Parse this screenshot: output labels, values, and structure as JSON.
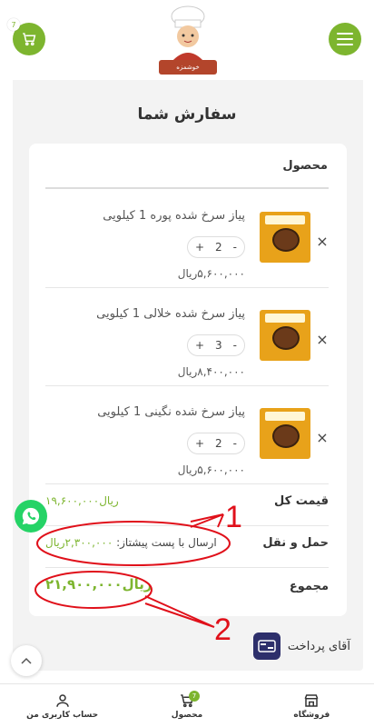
{
  "header": {
    "cart_count": "7",
    "logo_text": "خوشمزه"
  },
  "page": {
    "title": "سفارش شما"
  },
  "order": {
    "column_header": "محصول",
    "items": [
      {
        "name": "پیاز سرخ شده پوره 1 کیلویی",
        "qty": "2",
        "price": "۵,۶۰۰,۰۰۰ریال",
        "remove": "×",
        "minus": "-",
        "plus": "+"
      },
      {
        "name": "پیاز سرخ شده خلالی 1 کیلویی",
        "qty": "3",
        "price": "۸,۴۰۰,۰۰۰ریال",
        "remove": "×",
        "minus": "-",
        "plus": "+"
      },
      {
        "name": "پیاز سرخ شده نگینی 1 کیلویی",
        "qty": "2",
        "price": "۵,۶۰۰,۰۰۰ریال",
        "remove": "×",
        "minus": "-",
        "plus": "+"
      }
    ],
    "subtotal_label": "قیمت کل",
    "subtotal_value": "۱۹,۶۰۰,۰۰۰ریال",
    "shipping_label": "حمل و نقل",
    "shipping_method": "ارسال با پست پیشتاز:",
    "shipping_value": "۲,۳۰۰,۰۰۰ریال",
    "total_label": "مجموع",
    "total_value": "۲۱,۹۰۰,۰۰۰ریال"
  },
  "payment": {
    "label": "آقای پرداخت"
  },
  "annotations": {
    "marker_1": "1",
    "marker_2": "2"
  },
  "bottom_nav": {
    "shop_label": "فروشگاه",
    "product_label": "محصول",
    "product_badge": "7",
    "account_label": "حساب کاربری من"
  },
  "colors": {
    "accent": "#7db52f",
    "annotation": "#e0101a"
  }
}
